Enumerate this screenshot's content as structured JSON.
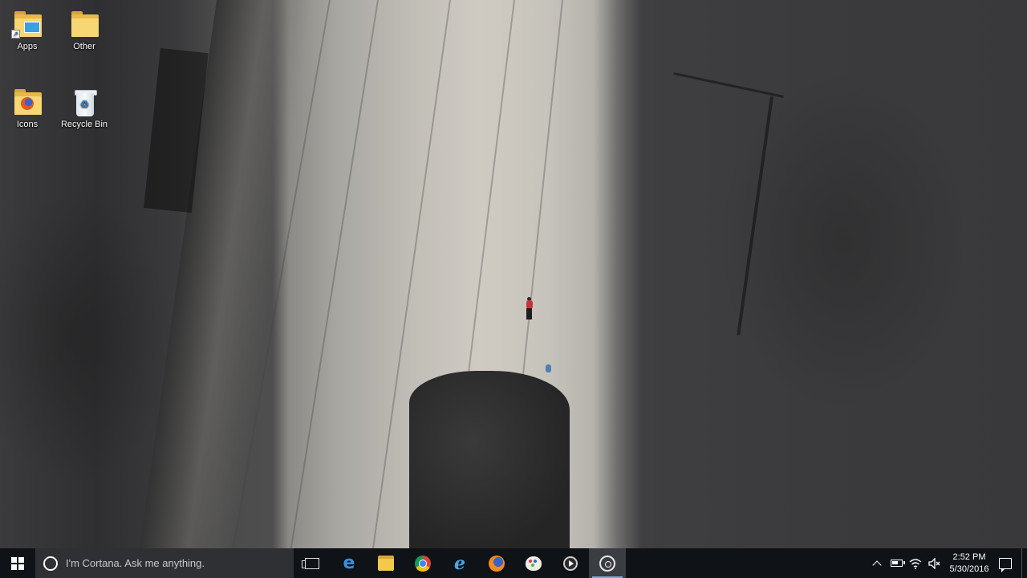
{
  "desktop": {
    "icons": [
      {
        "label": "Apps",
        "icon": "folder-shortcut-icon"
      },
      {
        "label": "Other",
        "icon": "folder-icon"
      },
      {
        "label": "Icons",
        "icon": "folder-firefox-icon"
      },
      {
        "label": "Recycle Bin",
        "icon": "recycle-bin-icon"
      }
    ],
    "wallpaper": "rock-climbing-cliff"
  },
  "taskbar": {
    "search_placeholder": "I'm Cortana. Ask me anything.",
    "pinned": [
      {
        "name": "task-view",
        "icon": "task-view-icon"
      },
      {
        "name": "edge",
        "icon": "edge-icon"
      },
      {
        "name": "file-explorer",
        "icon": "folder-icon"
      },
      {
        "name": "chrome",
        "icon": "chrome-icon"
      },
      {
        "name": "internet-explorer",
        "icon": "ie-icon"
      },
      {
        "name": "firefox",
        "icon": "firefox-icon"
      },
      {
        "name": "paint",
        "icon": "paint-palette-icon"
      },
      {
        "name": "media-player",
        "icon": "media-player-icon"
      },
      {
        "name": "obs",
        "icon": "obs-icon"
      }
    ],
    "active_app": "obs",
    "clock": {
      "time": "2:52 PM",
      "date": "5/30/2016"
    },
    "colors": {
      "bar": "#0f1216",
      "search": "#2e3034",
      "active_indicator": "#7ea9d6"
    }
  }
}
